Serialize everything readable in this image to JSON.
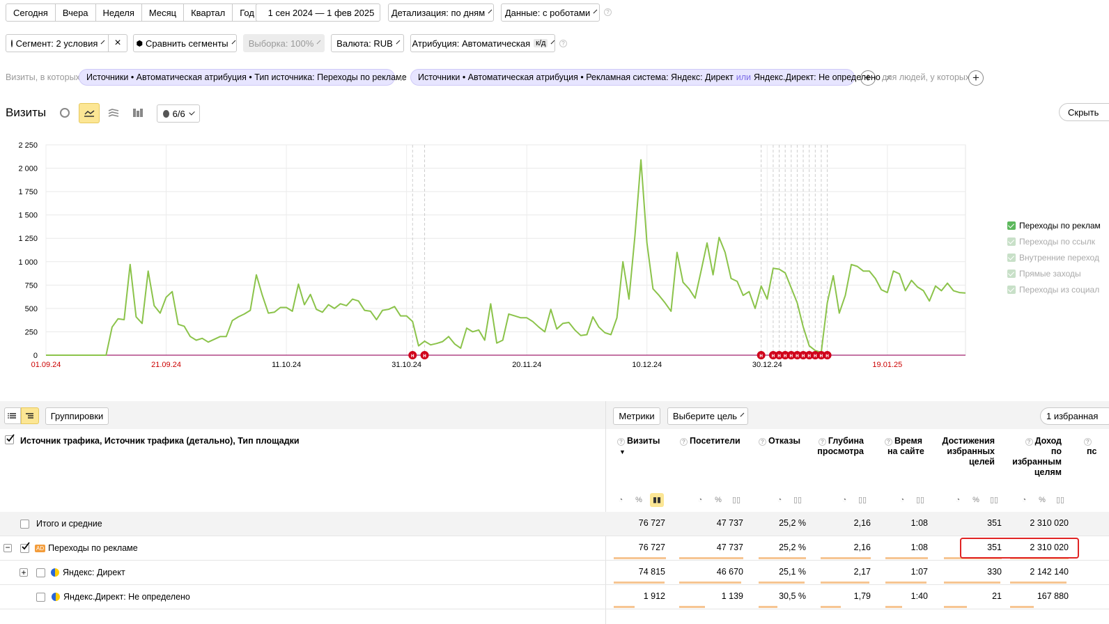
{
  "periods": [
    "Сегодня",
    "Вчера",
    "Неделя",
    "Месяц",
    "Квартал",
    "Год"
  ],
  "date_range": "1 сен 2024 — 1 фев 2025",
  "detail": "Детализация: по дням",
  "data_mode": "Данные: с роботами",
  "segment": "Сегмент: 2 условия",
  "compare": "Сравнить сегменты",
  "sample": "Выборка: 100%",
  "currency": "Валюта: RUB",
  "attribution": "Атрибуция: Автоматическая",
  "attribution_tag": "к/д",
  "filter": {
    "prefix": "Визиты, в которых",
    "chip1": "Источники • Автоматическая атрибуция • Тип источника: Переходы по рекламе",
    "and": "и",
    "chip2_a": "Источники • Автоматическая атрибуция • Рекламная система: Яндекс: Директ",
    "chip2_or": "или",
    "chip2_b": "Яндекс.Директ: Не определено",
    "people": "для людей, у которых"
  },
  "chart_header": {
    "title": "Визиты",
    "comments": "6/6",
    "hide": "Скрыть"
  },
  "chart_data": {
    "type": "line",
    "x_labels": [
      "01.09.24",
      "21.09.24",
      "11.10.24",
      "31.10.24",
      "20.11.24",
      "10.12.24",
      "30.12.24",
      "19.01.25"
    ],
    "y_ticks": [
      "0",
      "250",
      "500",
      "750",
      "1 000",
      "1 250",
      "1 500",
      "1 750",
      "2 000",
      "2 250"
    ],
    "ylim": [
      0,
      2250
    ],
    "grid": true,
    "legend_position": "right",
    "series": [
      {
        "name": "Переходы по рекламе",
        "start": "2024-09-01",
        "values": [
          0,
          0,
          0,
          0,
          0,
          0,
          0,
          0,
          0,
          0,
          0,
          300,
          390,
          380,
          970,
          410,
          340,
          900,
          530,
          450,
          620,
          680,
          330,
          310,
          200,
          160,
          180,
          140,
          170,
          200,
          200,
          370,
          410,
          440,
          480,
          860,
          640,
          450,
          460,
          510,
          510,
          470,
          760,
          540,
          650,
          490,
          460,
          540,
          500,
          550,
          530,
          600,
          580,
          480,
          470,
          380,
          480,
          490,
          520,
          420,
          420,
          360,
          100,
          150,
          110,
          125,
          145,
          200,
          120,
          75,
          290,
          250,
          270,
          160,
          550,
          130,
          160,
          440,
          420,
          400,
          400,
          360,
          300,
          250,
          490,
          280,
          340,
          350,
          270,
          210,
          220,
          410,
          300,
          240,
          220,
          400,
          1000,
          600,
          1280,
          2090,
          1200,
          710,
          640,
          560,
          470,
          1100,
          780,
          710,
          610,
          900,
          1200,
          860,
          1260,
          1100,
          820,
          790,
          640,
          680,
          500,
          740,
          600,
          930,
          920,
          880,
          720,
          560,
          300,
          100,
          50,
          30,
          560,
          850,
          450,
          640,
          970,
          950,
          900,
          900,
          820,
          700,
          670,
          900,
          870,
          690,
          800,
          730,
          690,
          580,
          740,
          690,
          770,
          690,
          670,
          665
        ]
      }
    ],
    "annotation_marker": "н",
    "legend": [
      {
        "label": "Переходы по реклам",
        "enabled": true
      },
      {
        "label": "Переходы по ссылк",
        "enabled": false
      },
      {
        "label": "Внутренние переход",
        "enabled": false
      },
      {
        "label": "Прямые заходы",
        "enabled": false
      },
      {
        "label": "Переходы из социал",
        "enabled": false
      }
    ]
  },
  "table_toolbar": {
    "groupings": "Группировки",
    "metrics": "Метрики",
    "goal": "Выберите цель",
    "favorites": "1 избранная"
  },
  "table": {
    "dimension_header": "Источник трафика, Источник трафика (детально), Тип площадки",
    "col_visits": "Визиты",
    "col_visits_sort": "▼",
    "col_visitors": "Посетители",
    "col_bounce": "Отказы",
    "col_depth_1": "Глубина",
    "col_depth_2": "просмотра",
    "col_time_1": "Время",
    "col_time_2": "на сайте",
    "col_goals_1": "Достижения",
    "col_goals_2": "избранных",
    "col_goals_3": "целей",
    "col_revenue_1": "Доход",
    "col_revenue_2": "по",
    "col_revenue_3": "избранным",
    "col_revenue_4": "целям",
    "col_extra_1": "пс",
    "rows": [
      {
        "label": "Итого и средние",
        "visits": "76 727",
        "visitors": "47 737",
        "bounce": "25,2 %",
        "depth": "2,16",
        "time": "1:08",
        "goals": "351",
        "revenue": "2 310 020"
      },
      {
        "label": "Переходы по рекламе",
        "badge": "AD",
        "visits": "76 727",
        "visitors": "47 737",
        "bounce": "25,2 %",
        "depth": "2,16",
        "time": "1:08",
        "goals": "351",
        "revenue": "2 310 020"
      },
      {
        "label": "Яндекс: Директ",
        "visits": "74 815",
        "visitors": "46 670",
        "bounce": "25,1 %",
        "depth": "2,17",
        "time": "1:07",
        "goals": "330",
        "revenue": "2 142 140"
      },
      {
        "label": "Яндекс.Директ: Не определено",
        "visits": "1 912",
        "visitors": "1 139",
        "bounce": "30,5 %",
        "depth": "1,79",
        "time": "1:40",
        "goals": "21",
        "revenue": "167 880"
      }
    ]
  }
}
